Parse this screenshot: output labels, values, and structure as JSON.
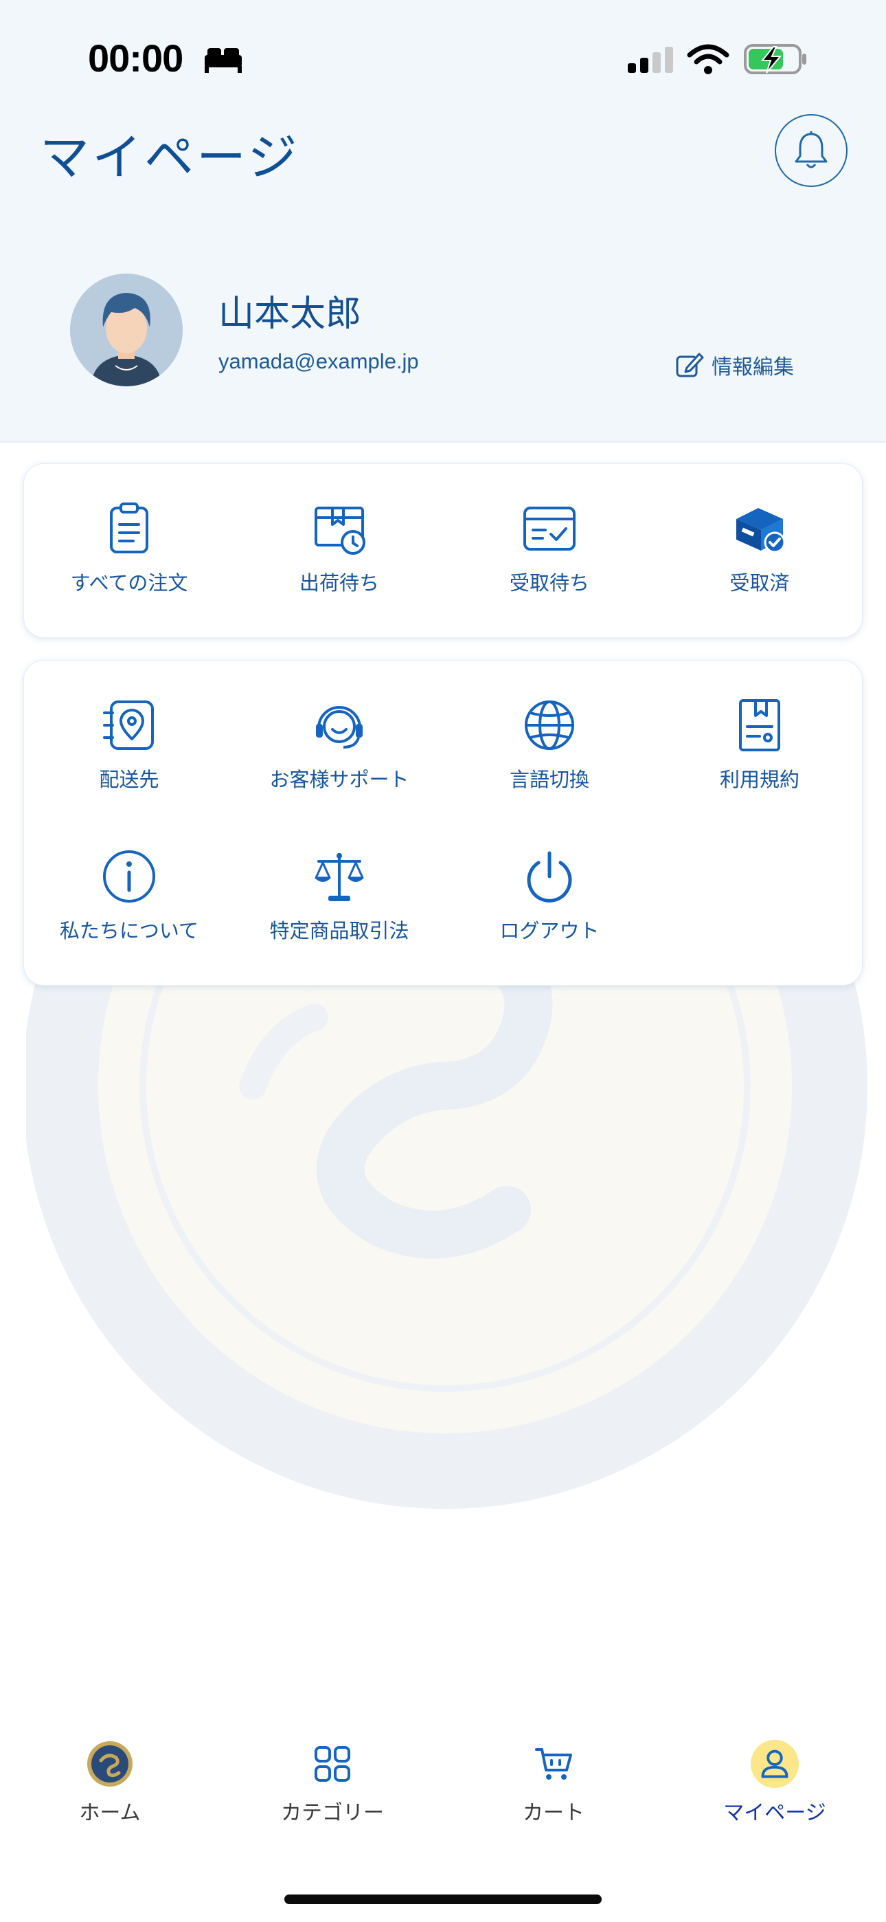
{
  "status_bar": {
    "time": "00:00"
  },
  "header": {
    "title": "マイページ"
  },
  "profile": {
    "name": "山本太郎",
    "email": "yamada@example.jp",
    "edit_label": "情報編集"
  },
  "orders": [
    {
      "label": "すべての注文",
      "icon": "clipboard-icon"
    },
    {
      "label": "出荷待ち",
      "icon": "shipping-clock-icon"
    },
    {
      "label": "受取待ち",
      "icon": "inbox-check-icon"
    },
    {
      "label": "受取済",
      "icon": "box-check-icon"
    }
  ],
  "services": [
    {
      "label": "配送先",
      "icon": "location-icon"
    },
    {
      "label": "お客様サポート",
      "icon": "headset-icon"
    },
    {
      "label": "言語切換",
      "icon": "globe-icon"
    },
    {
      "label": "利用規約",
      "icon": "terms-book-icon"
    },
    {
      "label": "私たちについて",
      "icon": "info-icon"
    },
    {
      "label": "特定商品取引法",
      "icon": "scale-icon"
    },
    {
      "label": "ログアウト",
      "icon": "power-icon"
    }
  ],
  "tab_bar": [
    {
      "label": "ホーム",
      "icon": "home-logo-icon",
      "active": false
    },
    {
      "label": "カテゴリー",
      "icon": "grid-icon",
      "active": false
    },
    {
      "label": "カート",
      "icon": "cart-icon",
      "active": false
    },
    {
      "label": "マイページ",
      "icon": "user-icon",
      "active": true
    }
  ],
  "colors": {
    "primary": "#1565c0",
    "title": "#0f4f96",
    "header_bg": "#f2f7fc",
    "active_tab_bg": "#fde68a",
    "active_tab_text": "#1233a8"
  }
}
